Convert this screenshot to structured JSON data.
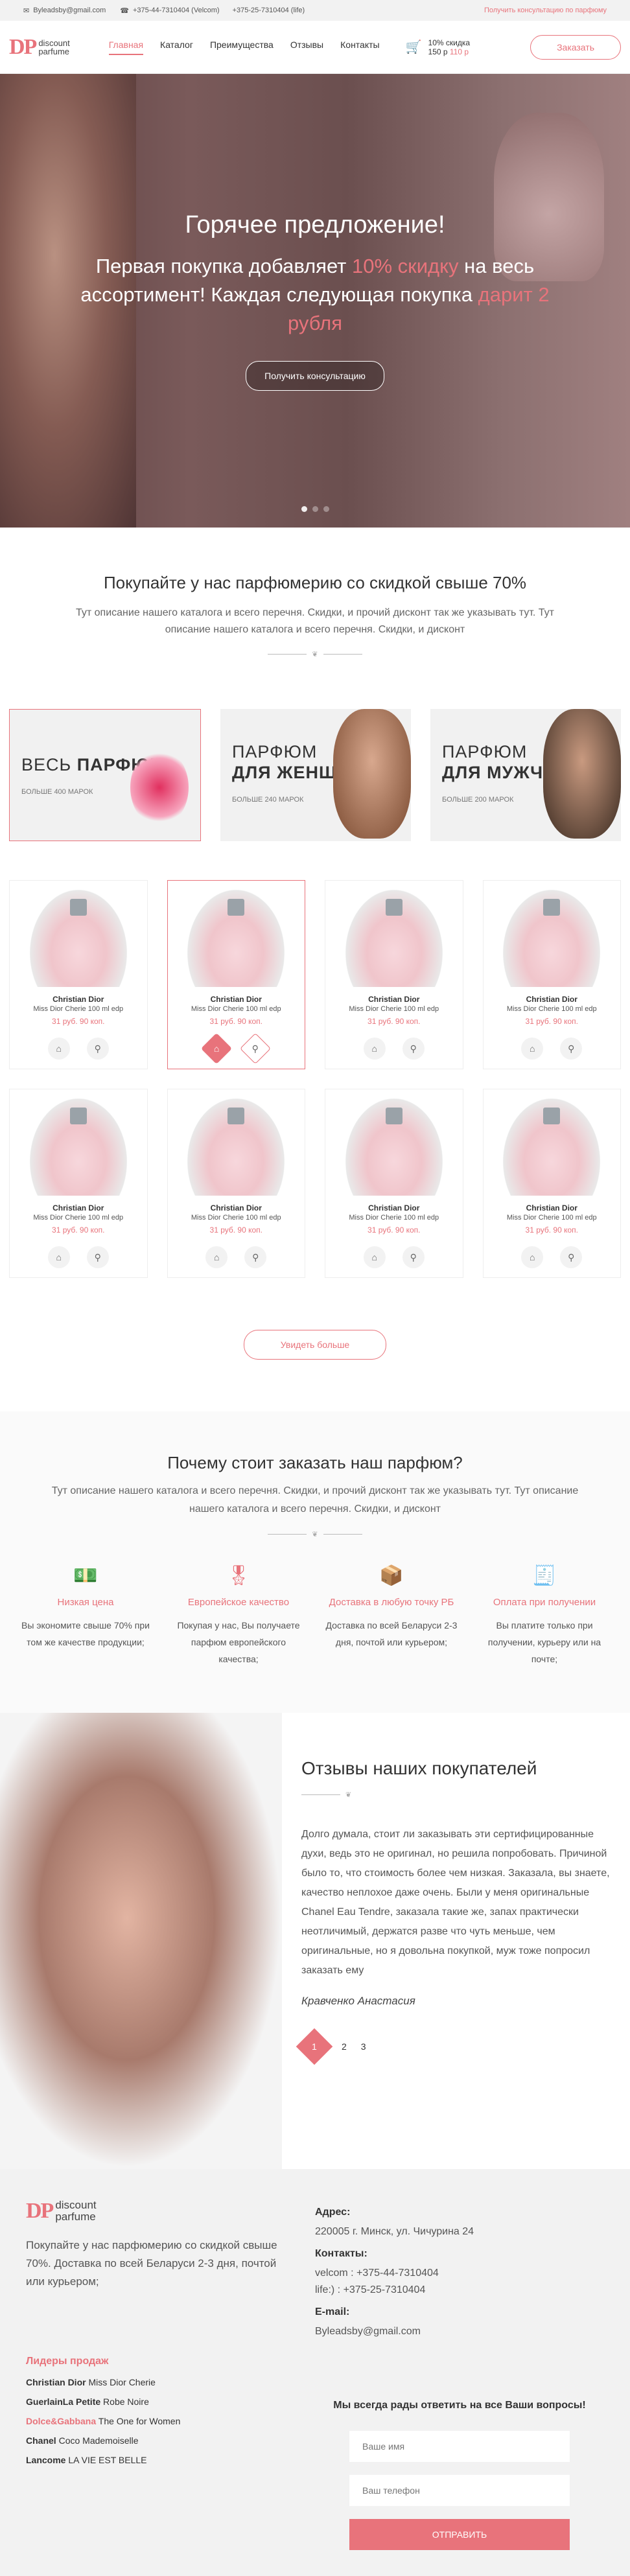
{
  "topbar": {
    "email": "Byleadsby@gmail.com",
    "phone1": "+375-44-7310404 (Velcom)",
    "phone2": "+375-25-7310404 (life)",
    "consult": "Получить консультацию по парфюму"
  },
  "header": {
    "logo_mark": "DP",
    "logo_line1": "discount",
    "logo_line2": "parfume",
    "nav": [
      "Главная",
      "Каталог",
      "Преимущества",
      "Отзывы",
      "Контакты"
    ],
    "cart_label": "10% скидка",
    "cart_price_new": "150 р",
    "cart_price_old": "110 р",
    "order_button": "Заказать"
  },
  "hero": {
    "title": "Горячее предложение!",
    "line1_a": "Первая покупка добавляет ",
    "line1_b": "10% скидку",
    "line1_c": " на весь ассортимент! Каждая следующая покупка ",
    "line1_d": "дарит 2 рубля",
    "button": "Получить консультацию"
  },
  "intro": {
    "title": "Покупайте у нас парфюмерию со скидкой свыше 70%",
    "text": "Тут описание нашего каталога и всего перечня. Скидки, и прочий дисконт так же указывать тут. Тут описание нашего каталога и всего перечня. Скидки, и дисконт"
  },
  "categories": [
    {
      "title_a": "ВЕСЬ ",
      "title_b": "ПАРФЮМ",
      "sub": "БОЛЬШЕ 400 МАРОК"
    },
    {
      "title_a": "ПАРФЮМ",
      "title_b": "ДЛЯ ЖЕНЩИН",
      "sub": "БОЛЬШЕ 240 МАРОК"
    },
    {
      "title_a": "ПАРФЮМ",
      "title_b": "ДЛЯ МУЖЧИН",
      "sub": "БОЛЬШЕ 200 МАРОК"
    }
  ],
  "products": [
    {
      "brand": "Christian Dior",
      "name": "Miss Dior Cherie 100 ml edp",
      "price": "31 руб. 90 коп."
    },
    {
      "brand": "Christian Dior",
      "name": "Miss Dior Cherie 100 ml edp",
      "price": "31 руб. 90 коп."
    },
    {
      "brand": "Christian Dior",
      "name": "Miss Dior Cherie 100 ml edp",
      "price": "31 руб. 90 коп."
    },
    {
      "brand": "Christian Dior",
      "name": "Miss Dior Cherie 100 ml edp",
      "price": "31 руб. 90 коп."
    },
    {
      "brand": "Christian Dior",
      "name": "Miss Dior Cherie 100 ml edp",
      "price": "31 руб. 90 коп."
    },
    {
      "brand": "Christian Dior",
      "name": "Miss Dior Cherie 100 ml edp",
      "price": "31 руб. 90 коп."
    },
    {
      "brand": "Christian Dior",
      "name": "Miss Dior Cherie 100 ml edp",
      "price": "31 руб. 90 коп."
    },
    {
      "brand": "Christian Dior",
      "name": "Miss Dior Cherie 100 ml edp",
      "price": "31 руб. 90 коп."
    }
  ],
  "show_more": "Увидеть больше",
  "why": {
    "title": "Почему стоит заказать наш парфюм?",
    "text": "Тут описание нашего каталога и всего перечня. Скидки, и прочий дисконт так же указывать тут. Тут описание нашего каталога и всего перечня. Скидки, и дисконт",
    "features": [
      {
        "title": "Низкая цена",
        "text": "Вы экономите свыше 70% при том же качестве продукции;"
      },
      {
        "title": "Европейское качество",
        "text": "Покупая у нас, Вы получаете парфюм европейского качества;"
      },
      {
        "title": "Доставка в любую точку РБ",
        "text": "Доставка по всей Беларуси 2-3 дня, почтой или курьером;"
      },
      {
        "title": "Оплата при получении",
        "text": "Вы платите только при получении, курьеру или на почте;"
      }
    ]
  },
  "reviews": {
    "title": "Отзывы наших покупателей",
    "text": "Долго думала, стоит ли заказывать эти сертифицированные духи, ведь это не оригинал, но решила попробовать. Причиной было то, что стоимость более чем низкая. Заказала, вы знаете, качество неплохое даже очень. Были у меня оригинальные Chanel Eau Tendre, заказала такие же, запах практически неотличимый, держатся разве что чуть меньше, чем оригинальные, но я довольна покупкой, муж тоже попросил заказать ему",
    "author": "Кравченко Анастасия",
    "pages": [
      "1",
      "2",
      "3"
    ]
  },
  "footer": {
    "text": "Покупайте у нас парфюмерию со скидкой свыше 70%. Доставка по всей Беларуси 2-3 дня, почтой или курьером;",
    "address_label": "Адрес:",
    "address": "220005 г. Минск, ул. Чичурина 24",
    "contacts_label": "Контакты:",
    "phone1": "velcom : +375-44-7310404",
    "phone2": "life:) : +375-25-7310404",
    "email_label": "E-mail:",
    "email": "Byleadsby@gmail.com",
    "leaders_title": "Лидеры продаж",
    "leaders": [
      {
        "brand": "Christian Dior",
        "name": "Miss Dior Cherie"
      },
      {
        "brand": "GuerlainLa Petite",
        "name": "Robe Noire"
      },
      {
        "brand": "Dolce&Gabbana",
        "name": "The One for Women"
      },
      {
        "brand": "Chanel",
        "name": "Coco Mademoiselle"
      },
      {
        "brand": "Lancome",
        "name": "LA VIE EST BELLE"
      }
    ],
    "form_title": "Мы всегда рады ответить на все Ваши вопросы!",
    "name_placeholder": "Ваше имя",
    "phone_placeholder": "Ваш телефон",
    "submit": "ОТПРАВИТЬ"
  }
}
